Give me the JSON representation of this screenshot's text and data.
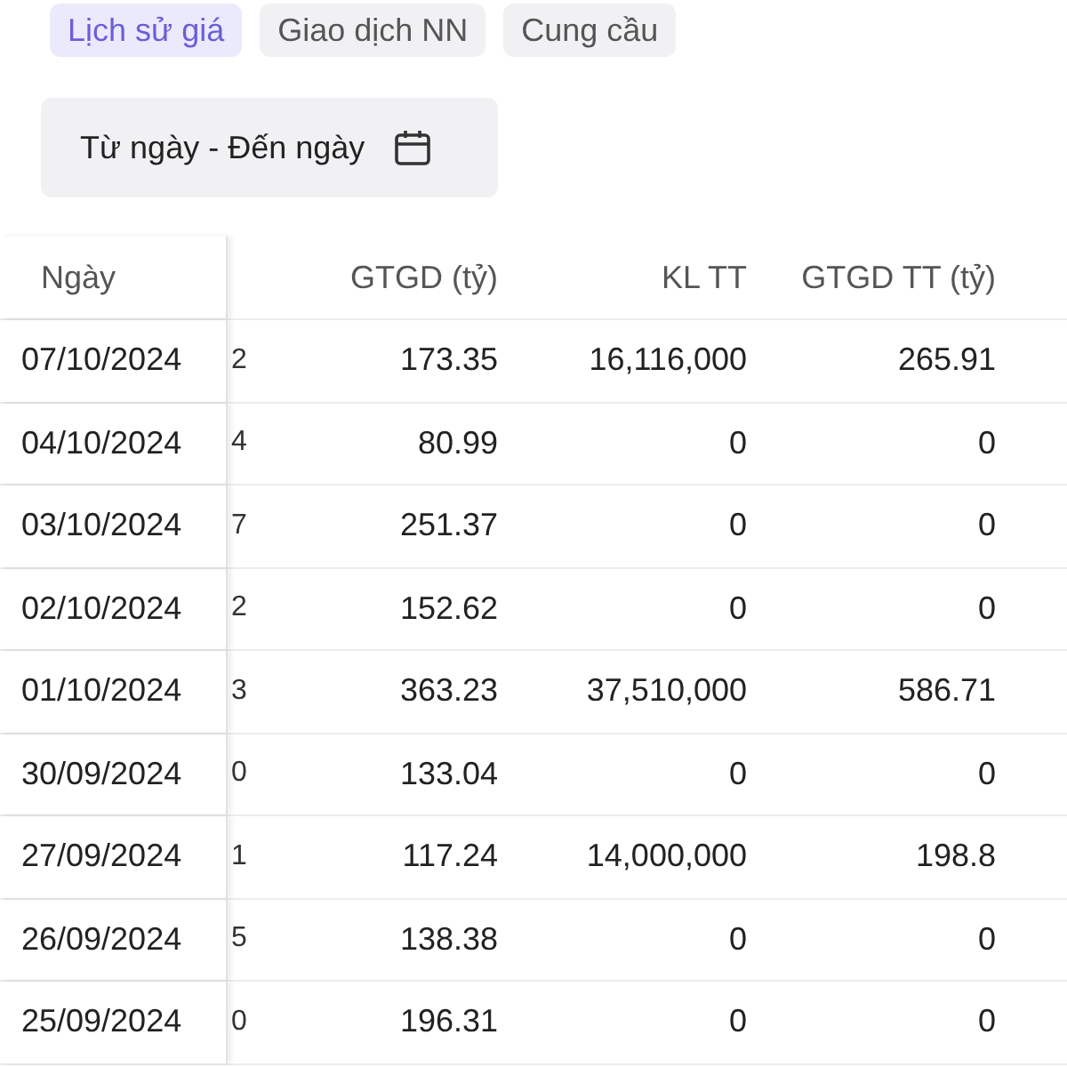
{
  "tabs": [
    {
      "label": "Lịch sử giá",
      "selected": true
    },
    {
      "label": "Giao dịch NN",
      "selected": false
    },
    {
      "label": "Cung cầu",
      "selected": false
    }
  ],
  "date_range": {
    "label": "Từ ngày - Đến ngày"
  },
  "table": {
    "columns": [
      "Ngày",
      "",
      "GTGD (tỷ)",
      "KL TT",
      "GTGD TT (tỷ)"
    ],
    "rows": [
      [
        "07/10/2024",
        "2",
        "173.35",
        "16,116,000",
        "265.91"
      ],
      [
        "04/10/2024",
        "4",
        "80.99",
        "0",
        "0"
      ],
      [
        "03/10/2024",
        "7",
        "251.37",
        "0",
        "0"
      ],
      [
        "02/10/2024",
        "2",
        "152.62",
        "0",
        "0"
      ],
      [
        "01/10/2024",
        "3",
        "363.23",
        "37,510,000",
        "586.71"
      ],
      [
        "30/09/2024",
        "0",
        "133.04",
        "0",
        "0"
      ],
      [
        "27/09/2024",
        "1",
        "117.24",
        "14,000,000",
        "198.8"
      ],
      [
        "26/09/2024",
        "5",
        "138.38",
        "0",
        "0"
      ],
      [
        "25/09/2024",
        "0",
        "196.31",
        "0",
        "0"
      ]
    ]
  }
}
